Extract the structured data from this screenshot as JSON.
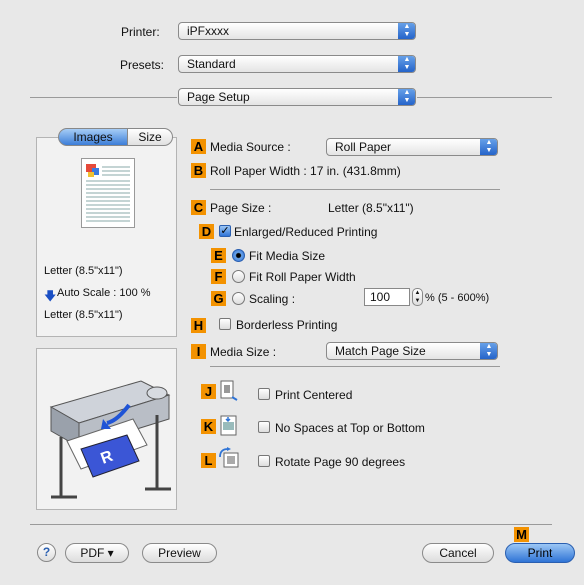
{
  "printer": {
    "label": "Printer:",
    "value": "iPFxxxx"
  },
  "presets": {
    "label": "Presets:",
    "value": "Standard"
  },
  "panel_select": {
    "value": "Page Setup"
  },
  "tabs": {
    "images": "Images",
    "size": "Size"
  },
  "preview_info": {
    "paper": "Letter (8.5\"x11\")",
    "auto_scale": "Auto Scale : 100 %",
    "output": "Letter (8.5\"x11\")"
  },
  "badges": {
    "A": "A",
    "B": "B",
    "C": "C",
    "D": "D",
    "E": "E",
    "F": "F",
    "G": "G",
    "H": "H",
    "I": "I",
    "J": "J",
    "K": "K",
    "L": "L",
    "M": "M"
  },
  "media_source": {
    "label": "Media Source :",
    "value": "Roll Paper"
  },
  "roll_width": {
    "text": "Roll Paper Width : 17 in. (431.8mm)"
  },
  "page_size": {
    "label": "Page Size :",
    "value": "Letter (8.5\"x11\")"
  },
  "enlarged": {
    "label": "Enlarged/Reduced Printing",
    "checked": true
  },
  "fit_media": {
    "label": "Fit Media Size",
    "selected": true
  },
  "fit_roll": {
    "label": "Fit Roll Paper Width",
    "selected": false
  },
  "scaling": {
    "label": "Scaling :",
    "value": "100",
    "range": "% (5 - 600%)",
    "selected": false
  },
  "borderless": {
    "label": "Borderless Printing",
    "checked": false
  },
  "media_size": {
    "label": "Media Size :",
    "value": "Match Page Size"
  },
  "print_centered": {
    "label": "Print Centered",
    "checked": false
  },
  "no_spaces": {
    "label": "No Spaces at Top or Bottom",
    "checked": false
  },
  "rotate": {
    "label": "Rotate Page 90 degrees",
    "checked": false
  },
  "footer": {
    "help": "?",
    "pdf": "PDF ▾",
    "preview": "Preview",
    "cancel": "Cancel",
    "print": "Print"
  },
  "colors": {
    "badge": "#f39200",
    "accent": "#2f74d6"
  }
}
